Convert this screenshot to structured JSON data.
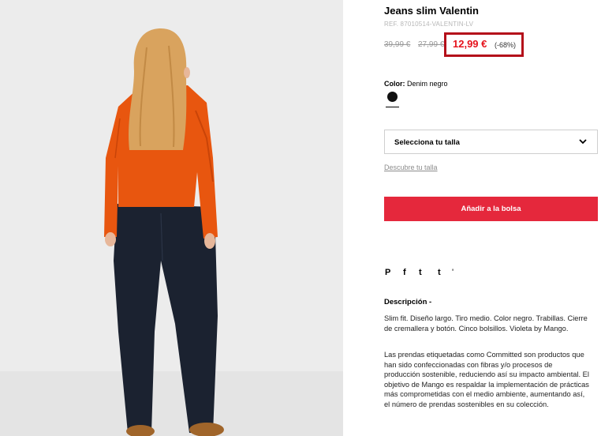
{
  "product": {
    "title": "Jeans slim Valentin",
    "ref": "REF. 87010514-VALENTIN-LV",
    "old_prices": [
      "39,99 €",
      "27,99 €"
    ],
    "price": "12,99 €",
    "discount": "(-68%)",
    "color_label": "Color:",
    "color_value": "Denim negro",
    "size_select_label": "Selecciona tu talla",
    "size_guide_link": "Descubre tu talla",
    "add_button": "Añadir a la bolsa"
  },
  "share": {
    "icons": [
      "pinterest-icon",
      "facebook-icon",
      "twitter-icon",
      "tumblr-icon"
    ],
    "glyphs": [
      "P",
      "f",
      "t",
      "t"
    ],
    "extra": "'"
  },
  "description": {
    "heading": "Descripción -",
    "paragraph1": "Slim fit. Diseño largo. Tiro medio. Color negro. Trabillas. Cierre de cremallera y botón. Cinco bolsillos. Violeta by Mango.",
    "paragraph2": "Las prendas etiquetadas como Committed son productos que han sido confeccionadas con fibras y/o procesos de producción sostenible, reduciendo así su impacto ambiental. El objetivo de Mango es respaldar la implementación de prácticas más comprometidas con el medio ambiente, aumentando así, el número de prendas sostenibles en su colección."
  },
  "colors": {
    "accent_red": "#e5283c",
    "price_red": "#e5131c",
    "highlight_border": "#b40f1a",
    "swatch": "#111111"
  }
}
